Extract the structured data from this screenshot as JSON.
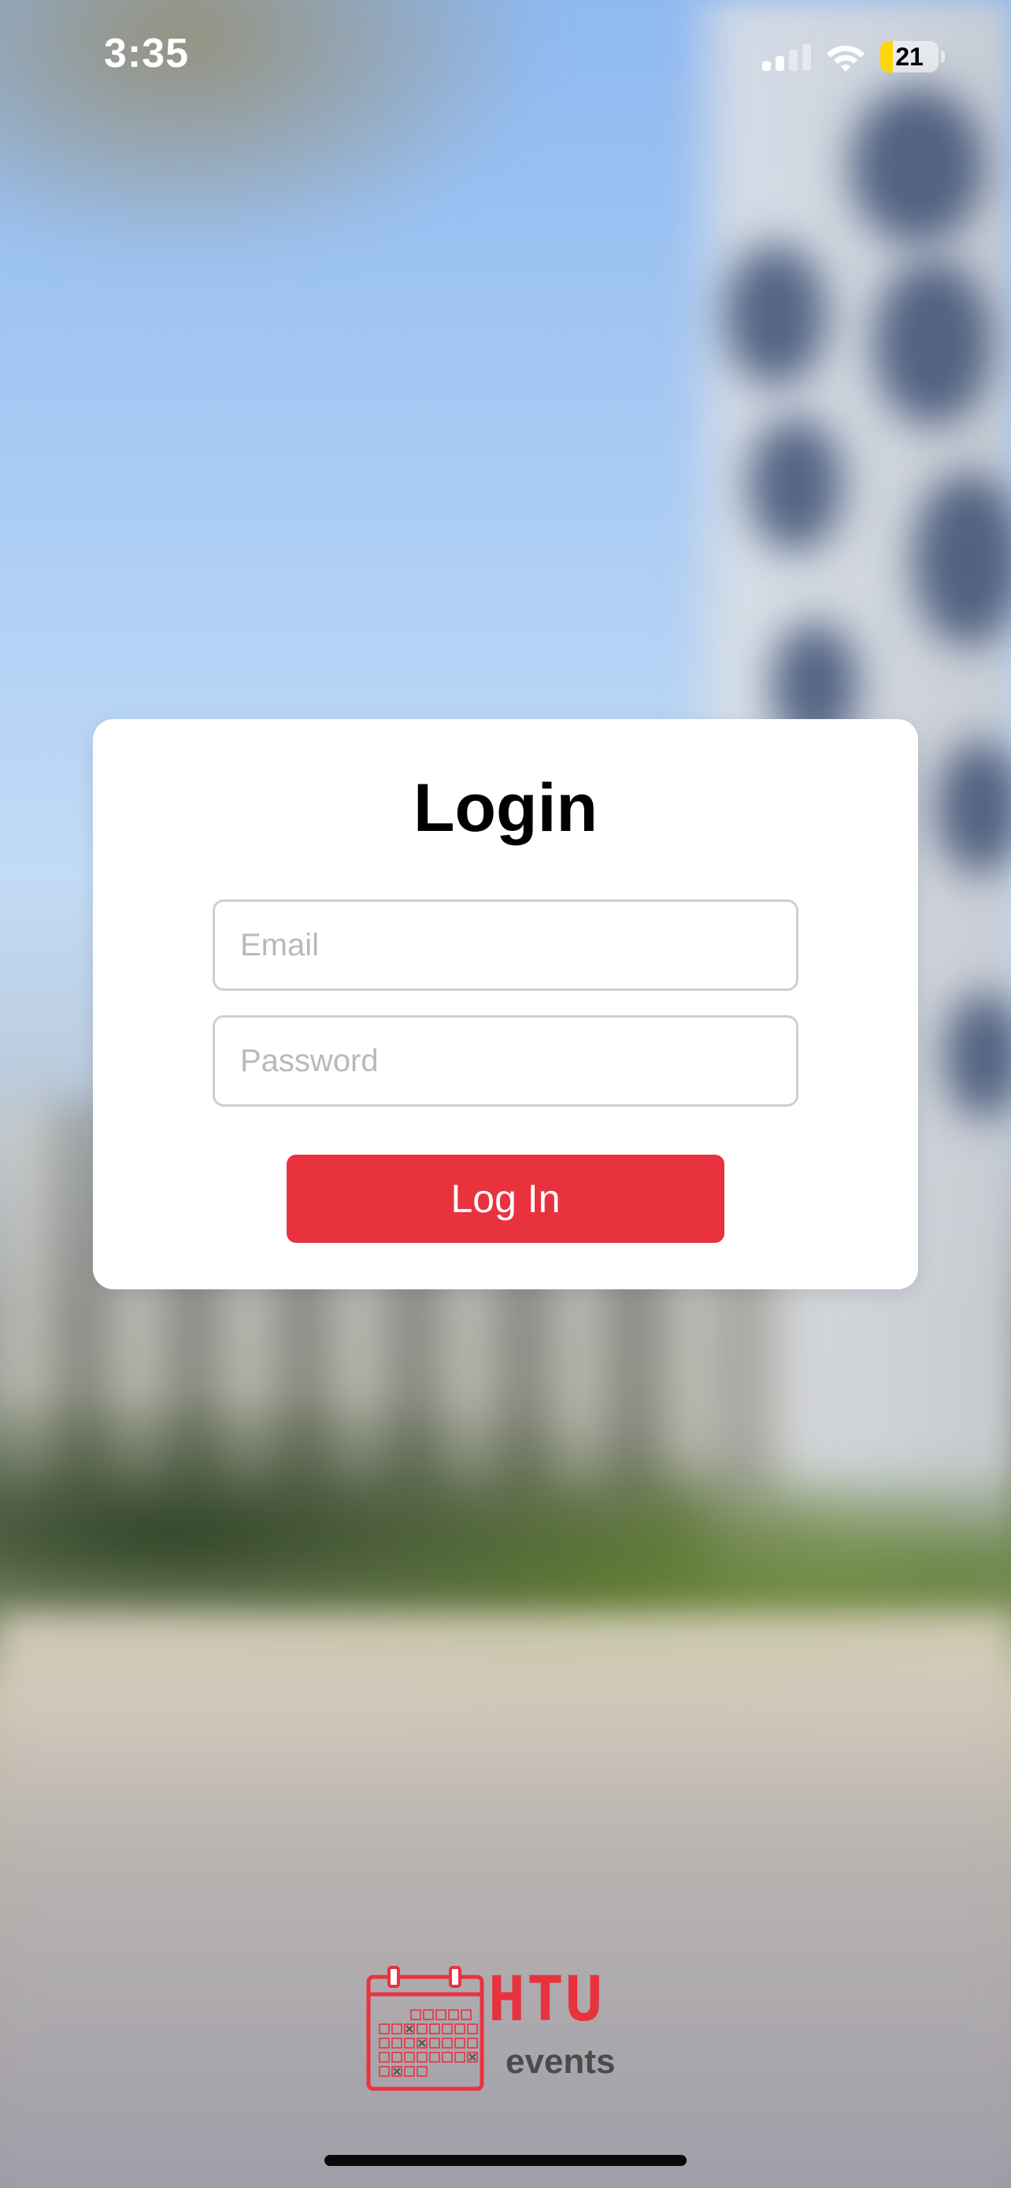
{
  "status_bar": {
    "time": "3:35",
    "battery_level": "21",
    "battery_fraction": 0.21,
    "battery_color": "#ffd60a"
  },
  "login": {
    "title": "Login",
    "email_placeholder": "Email",
    "password_placeholder": "Password",
    "button_label": "Log In",
    "button_color": "#e8333f"
  },
  "logo": {
    "brand": "HTU",
    "subtitle": "events",
    "icon": "calendar-icon"
  }
}
